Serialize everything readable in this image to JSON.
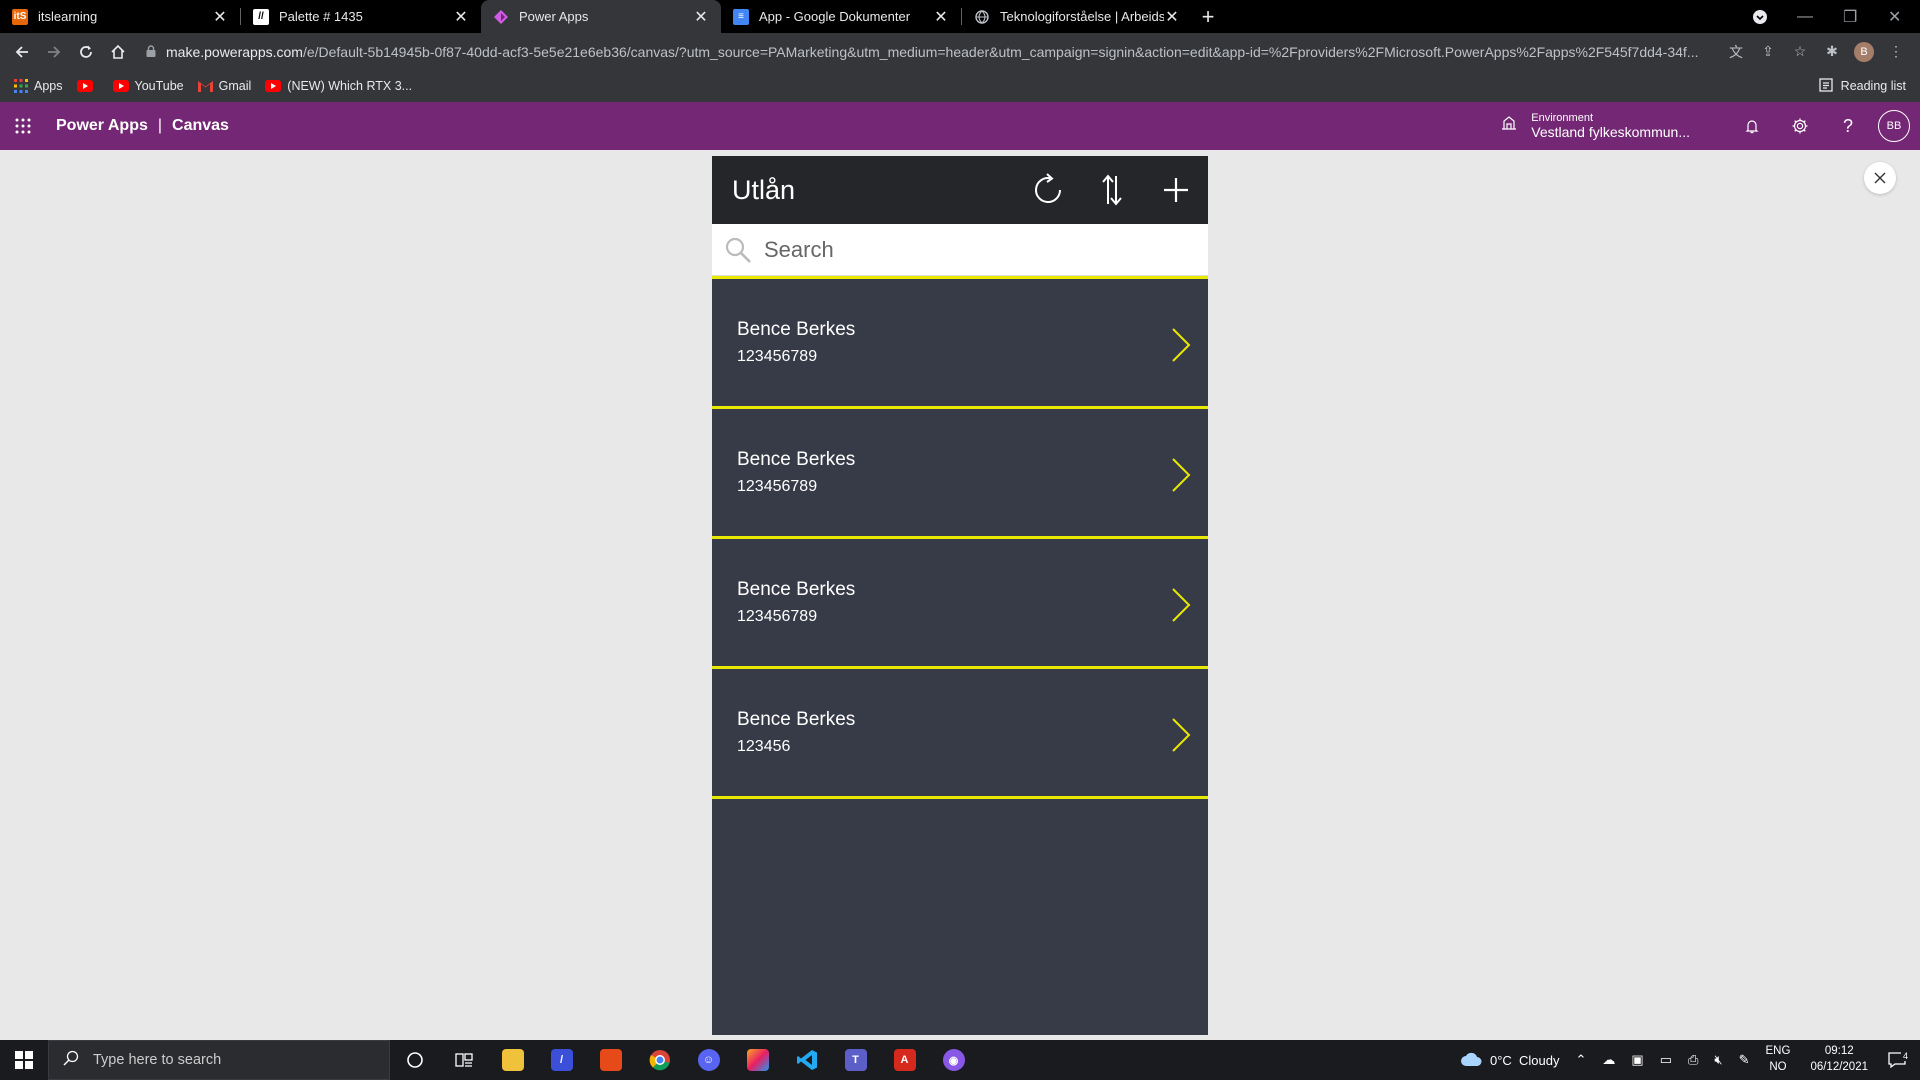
{
  "browser": {
    "tabs": [
      {
        "title": "itslearning",
        "favicon": "itslearning-icon",
        "active": false
      },
      {
        "title": "Palette # 1435",
        "favicon": "palette-icon",
        "active": false
      },
      {
        "title": "Power Apps",
        "favicon": "powerapps-icon",
        "active": true
      },
      {
        "title": "App - Google Dokumenter",
        "favicon": "google-docs-icon",
        "active": false
      },
      {
        "title": "Teknologiforståelse | Arbeidsbok",
        "favicon": "globe-icon",
        "active": false
      }
    ],
    "url_host": "make.powerapps.com",
    "url_rest": "/e/Default-5b14945b-0f87-40dd-acf3-5e5e21e6eb36/canvas/?utm_source=PAMarketing&utm_medium=header&utm_campaign=signin&action=edit&app-id=%2Fproviders%2FMicrosoft.PowerApps%2Fapps%2F545f7dd4-34f...",
    "profile_initial": "B",
    "bookmarks": [
      {
        "label": "Apps",
        "icon": "apps-grid-icon"
      },
      {
        "label": "",
        "icon": "youtube-icon"
      },
      {
        "label": "YouTube",
        "icon": "youtube-icon"
      },
      {
        "label": "Gmail",
        "icon": "gmail-icon"
      },
      {
        "label": "(NEW) Which RTX 3...",
        "icon": "youtube-icon"
      }
    ],
    "reading_list": "Reading list"
  },
  "powerapps": {
    "brand": "Power Apps",
    "separator": "|",
    "section": "Canvas",
    "environment_label": "Environment",
    "environment_value": "Vestland fylkeskommun...",
    "user_initials": "BB",
    "accent": "#742774"
  },
  "app": {
    "title": "Utlån",
    "search_placeholder": "Search",
    "accent": "#e8e800",
    "items": [
      {
        "name": "Bence Berkes",
        "number": "123456789"
      },
      {
        "name": "Bence Berkes",
        "number": "123456789"
      },
      {
        "name": "Bence Berkes",
        "number": "123456789"
      },
      {
        "name": "Bence Berkes",
        "number": "123456"
      }
    ]
  },
  "taskbar": {
    "search_placeholder": "Type here to search",
    "weather": "0°C  Cloudy",
    "lang_top": "ENG",
    "lang_bottom": "NO",
    "time": "09:12",
    "date": "06/12/2021",
    "notifications": "4",
    "pinned": [
      "cortana-icon",
      "task-view-icon",
      "file-explorer-icon",
      "powerapps-icon",
      "office-icon",
      "chrome-icon",
      "discord-icon",
      "paint-icon",
      "vscode-icon",
      "teams-icon",
      "acrobat-icon",
      "github-desktop-icon"
    ]
  }
}
